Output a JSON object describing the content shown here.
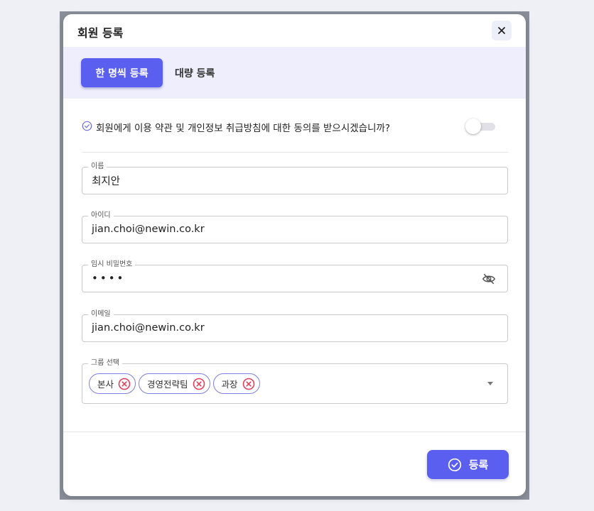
{
  "modal": {
    "title": "회원 등록",
    "close_icon": "close-icon"
  },
  "tabs": [
    {
      "label": "한 명씩 등록",
      "active": true
    },
    {
      "label": "대량 등록",
      "active": false
    }
  ],
  "consent": {
    "icon": "check-circle-icon",
    "text": "회원에게 이용 약관 및 개인정보 취급방침에 대한 동의를 받으시겠습니까?",
    "toggle_on": false
  },
  "fields": {
    "name": {
      "label": "이름",
      "value": "최지안"
    },
    "user_id": {
      "label": "아이디",
      "value": "jian.choi@newin.co.kr"
    },
    "temp_password": {
      "label": "임시 비밀번호",
      "value": "••••",
      "visibility_icon": "eye-off-icon"
    },
    "email": {
      "label": "이메일",
      "value": "jian.choi@newin.co.kr"
    },
    "group": {
      "label": "그룹 선택",
      "selected": [
        "본사",
        "경영전략팀",
        "과장"
      ]
    }
  },
  "submit": {
    "label": "등록",
    "icon": "check-circle-icon"
  },
  "colors": {
    "accent": "#5b5ff0",
    "tab_bar_bg": "#eeeefc",
    "chip_remove": "#e0405a"
  }
}
